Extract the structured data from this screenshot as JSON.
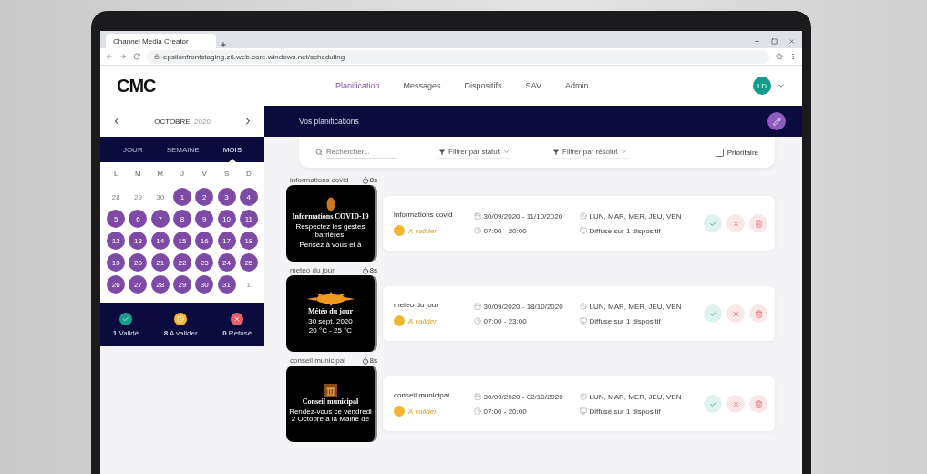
{
  "browser": {
    "tab_title": "Channel Media Creator",
    "url": "epsilonfrontstaging.z6.web.core.windows.net/scheduling"
  },
  "header": {
    "logo": "CMC",
    "nav": [
      {
        "label": "Planification",
        "selected": true
      },
      {
        "label": "Messages",
        "selected": false
      },
      {
        "label": "Dispositifs",
        "selected": false
      },
      {
        "label": "SAV",
        "selected": false
      },
      {
        "label": "Admin",
        "selected": false
      }
    ],
    "avatar": "LD"
  },
  "calendar": {
    "month": "OCTOBRE,",
    "year": "2020",
    "views": [
      {
        "label": "JOUR",
        "selected": false
      },
      {
        "label": "SEMAINE",
        "selected": false
      },
      {
        "label": "MOIS",
        "selected": true
      }
    ],
    "weekdays": [
      "L",
      "M",
      "M",
      "J",
      "V",
      "S",
      "D"
    ],
    "days": [
      {
        "label": "28",
        "highlighted": false
      },
      {
        "label": "29",
        "highlighted": false
      },
      {
        "label": "30",
        "highlighted": false
      },
      {
        "label": "1",
        "highlighted": true
      },
      {
        "label": "2",
        "highlighted": true
      },
      {
        "label": "3",
        "highlighted": true
      },
      {
        "label": "4",
        "highlighted": true
      },
      {
        "label": "5",
        "highlighted": true
      },
      {
        "label": "6",
        "highlighted": true
      },
      {
        "label": "7",
        "highlighted": true
      },
      {
        "label": "8",
        "highlighted": true
      },
      {
        "label": "9",
        "highlighted": true
      },
      {
        "label": "10",
        "highlighted": true
      },
      {
        "label": "11",
        "highlighted": true
      },
      {
        "label": "12",
        "highlighted": true
      },
      {
        "label": "13",
        "highlighted": true
      },
      {
        "label": "14",
        "highlighted": true
      },
      {
        "label": "15",
        "highlighted": true
      },
      {
        "label": "16",
        "highlighted": true
      },
      {
        "label": "17",
        "highlighted": true
      },
      {
        "label": "18",
        "highlighted": true
      },
      {
        "label": "19",
        "highlighted": true
      },
      {
        "label": "20",
        "highlighted": true
      },
      {
        "label": "21",
        "highlighted": true
      },
      {
        "label": "22",
        "highlighted": true
      },
      {
        "label": "23",
        "highlighted": true
      },
      {
        "label": "24",
        "highlighted": true
      },
      {
        "label": "25",
        "highlighted": true
      },
      {
        "label": "26",
        "highlighted": true
      },
      {
        "label": "27",
        "highlighted": true
      },
      {
        "label": "28",
        "highlighted": true
      },
      {
        "label": "29",
        "highlighted": true
      },
      {
        "label": "30",
        "highlighted": true
      },
      {
        "label": "31",
        "highlighted": true
      },
      {
        "label": "1",
        "highlighted": false
      }
    ],
    "stats": [
      {
        "kind": "validated",
        "count": "1",
        "label": "Validé",
        "color": "#1a9c8c"
      },
      {
        "kind": "pending",
        "count": "8",
        "label": "A valider",
        "color": "#f2b632"
      },
      {
        "kind": "refused",
        "count": "0",
        "label": "Refusé",
        "color": "#e8606a"
      }
    ]
  },
  "main": {
    "title": "Vos planifications",
    "search": {
      "placeholder": "Rechercher..."
    },
    "filters": [
      "Filtrer par statut",
      "Filtrer par résolut"
    ],
    "priority": {
      "label": "Prioritaire",
      "checked": false
    },
    "plannings": [
      {
        "caption": "informations covid",
        "duration": "8s",
        "preview": {
          "kind": "covid",
          "title": "Informations COVID-19",
          "lines": [
            "Respectez les gestes barrières.",
            "Pensez à vous et à"
          ]
        },
        "name": "informations covid",
        "status": "A valider",
        "dates": "30/09/2020 - 11/10/2020",
        "hours": "07:00 - 20:00",
        "weekdays": "LUN, MAR, MER, JEU, VEN",
        "devices": "Diffuse sur 1 dispositif"
      },
      {
        "caption": "meteo du jour",
        "duration": "8s",
        "preview": {
          "kind": "weather",
          "title": "Météo du jour",
          "lines": [
            "30 sept. 2020",
            "20 °C - 25 °C"
          ]
        },
        "name": "meteo du jour",
        "status": "A valider",
        "dates": "30/09/2020 - 18/10/2020",
        "hours": "07:00 - 23:00",
        "weekdays": "LUN, MAR, MER, JEU, VEN",
        "devices": "Diffuse sur 1 dispositif"
      },
      {
        "caption": "conseil municipal",
        "duration": "8s",
        "preview": {
          "kind": "council",
          "title": "Conseil municipal",
          "lines": [
            "Rendez-vous ce vendredi 2 Octobre à la Mairie de"
          ]
        },
        "name": "conseil municipal",
        "status": "A valider",
        "dates": "30/09/2020 - 02/10/2020",
        "hours": "07:00 - 20:00",
        "weekdays": "LUN, MAR, MER, JEU, VEN",
        "devices": "Diffusé sur 1 dispositif"
      }
    ]
  }
}
